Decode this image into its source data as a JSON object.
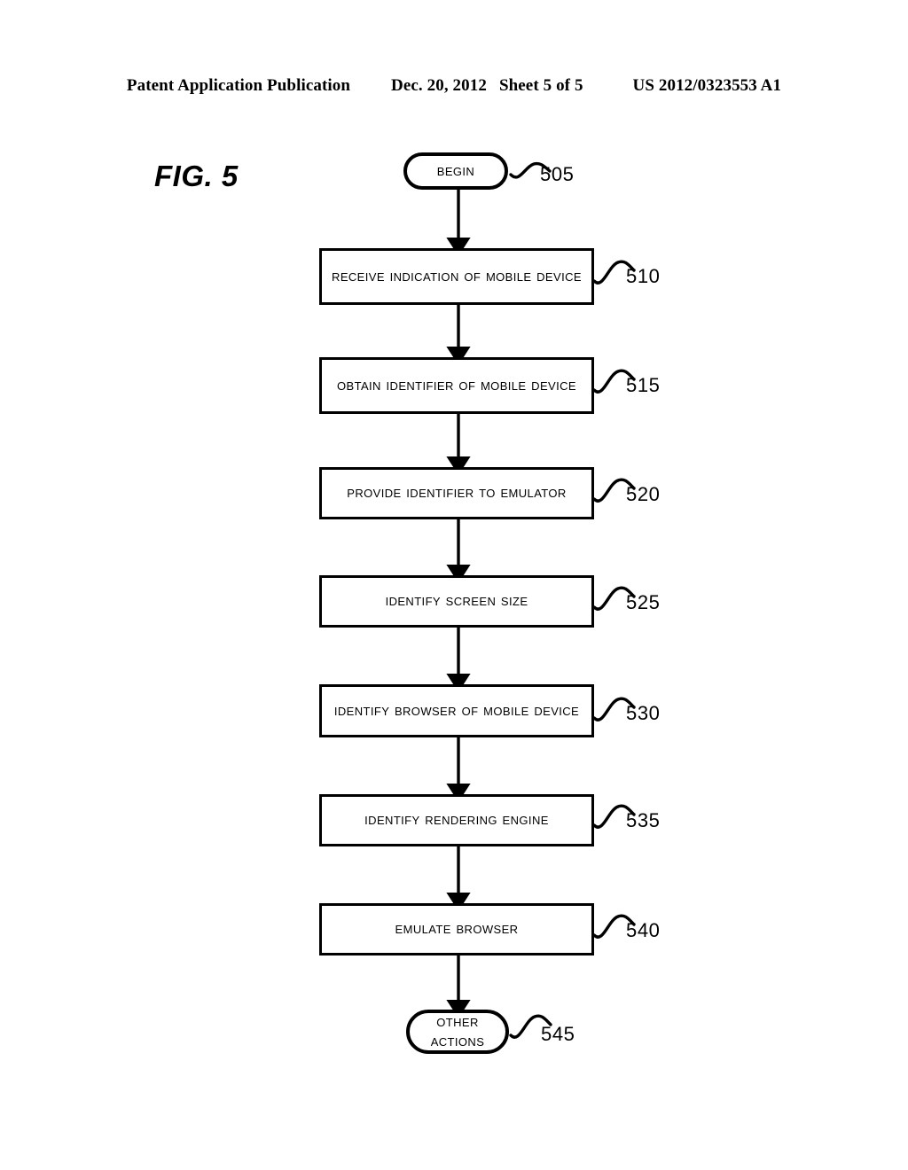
{
  "header": {
    "publication": "Patent Application Publication",
    "date": "Dec. 20, 2012",
    "sheet": "Sheet 5 of 5",
    "patent_number": "US 2012/0323553 A1"
  },
  "figure": {
    "label": "FIG. 5"
  },
  "chart_data": {
    "type": "diagram",
    "diagram_kind": "flowchart",
    "title": "FIG. 5",
    "orientation": "top-to-bottom",
    "nodes": [
      {
        "ref": "505",
        "shape": "terminator",
        "label": "Begin"
      },
      {
        "ref": "510",
        "shape": "process",
        "label": "Receive Indication of Mobile Device"
      },
      {
        "ref": "515",
        "shape": "process",
        "label": "Obtain Identifier of Mobile Device"
      },
      {
        "ref": "520",
        "shape": "process",
        "label": "Provide Identifier to Emulator"
      },
      {
        "ref": "525",
        "shape": "process",
        "label": "Identify Screen Size"
      },
      {
        "ref": "530",
        "shape": "process",
        "label": "Identify Browser of Mobile Device"
      },
      {
        "ref": "535",
        "shape": "process",
        "label": "Identify Rendering Engine"
      },
      {
        "ref": "540",
        "shape": "process",
        "label": "Emulate Browser"
      },
      {
        "ref": "545",
        "shape": "terminator",
        "label": "Other Actions"
      }
    ],
    "edges": [
      {
        "from": "505",
        "to": "510",
        "style": "arrow"
      },
      {
        "from": "510",
        "to": "515",
        "style": "arrow"
      },
      {
        "from": "515",
        "to": "520",
        "style": "arrow"
      },
      {
        "from": "520",
        "to": "525",
        "style": "arrow"
      },
      {
        "from": "525",
        "to": "530",
        "style": "arrow"
      },
      {
        "from": "530",
        "to": "535",
        "style": "arrow"
      },
      {
        "from": "535",
        "to": "540",
        "style": "arrow"
      },
      {
        "from": "540",
        "to": "545",
        "style": "arrow"
      }
    ],
    "colors": {
      "line": "#000000",
      "fill": "#ffffff",
      "text": "#000000"
    }
  },
  "nodes": {
    "n505": {
      "label": "Begin",
      "ref": "505"
    },
    "n510": {
      "label": "Receive Indication of Mobile Device",
      "ref": "510"
    },
    "n515": {
      "label": "Obtain Identifier of Mobile Device",
      "ref": "515"
    },
    "n520": {
      "label": "Provide Identifier to Emulator",
      "ref": "520"
    },
    "n525": {
      "label": "Identify Screen Size",
      "ref": "525"
    },
    "n530": {
      "label": "Identify Browser of Mobile Device",
      "ref": "530"
    },
    "n535": {
      "label": "Identify Rendering Engine",
      "ref": "535"
    },
    "n540": {
      "label": "Emulate Browser",
      "ref": "540"
    },
    "n545": {
      "label": "Other Actions",
      "ref": "545"
    }
  }
}
